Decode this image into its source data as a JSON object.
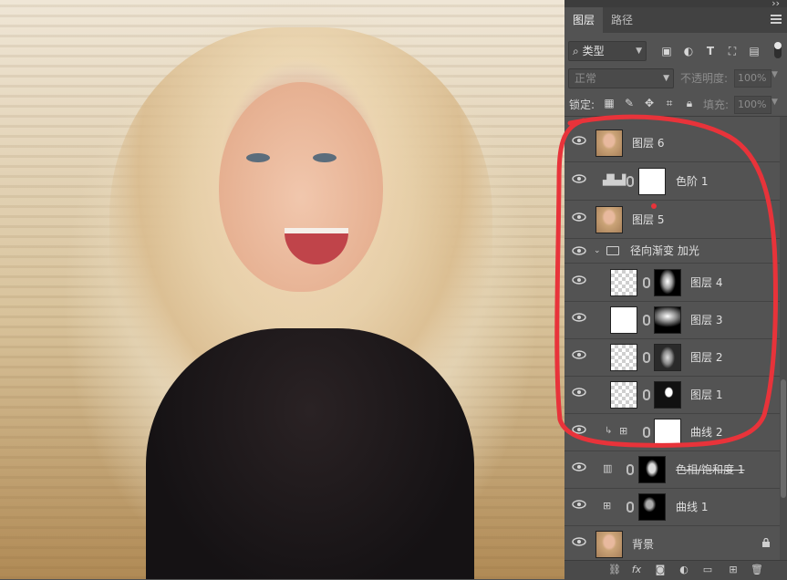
{
  "tabs": [
    {
      "label": "图层",
      "active": true
    },
    {
      "label": "路径",
      "active": false
    }
  ],
  "filter": {
    "kind_label": "类型"
  },
  "blend": {
    "mode": "正常",
    "opacity_label": "不透明度:",
    "opacity_value": "100%"
  },
  "lock": {
    "label": "锁定:",
    "fill_label": "填充:",
    "fill_value": "100%"
  },
  "layers": [
    {
      "name": "图层 6",
      "kind": "pixel",
      "visible": true
    },
    {
      "name": "色阶 1",
      "kind": "levels-adjustment",
      "visible": true
    },
    {
      "name": "图层 5",
      "kind": "pixel",
      "visible": true
    },
    {
      "name": "径向渐变 加光",
      "kind": "group",
      "visible": true,
      "expanded": true
    },
    {
      "name": "图层 4",
      "kind": "pixel-with-mask",
      "visible": true
    },
    {
      "name": "图层 3",
      "kind": "pixel-with-mask",
      "visible": true
    },
    {
      "name": "图层 2",
      "kind": "pixel-with-mask",
      "visible": true
    },
    {
      "name": "图层 1",
      "kind": "pixel-with-mask",
      "visible": true
    },
    {
      "name": "曲线 2",
      "kind": "curves-adjustment",
      "visible": true
    },
    {
      "name": "色相/饱和度 1",
      "kind": "hue-saturation-adjustment",
      "visible": true
    },
    {
      "name": "曲线 1",
      "kind": "curves-adjustment",
      "visible": true
    },
    {
      "name": "背景",
      "kind": "background",
      "visible": true,
      "locked": true
    }
  ],
  "colors": {
    "panel_bg": "#535353",
    "annotation_red": "#e8333a"
  }
}
